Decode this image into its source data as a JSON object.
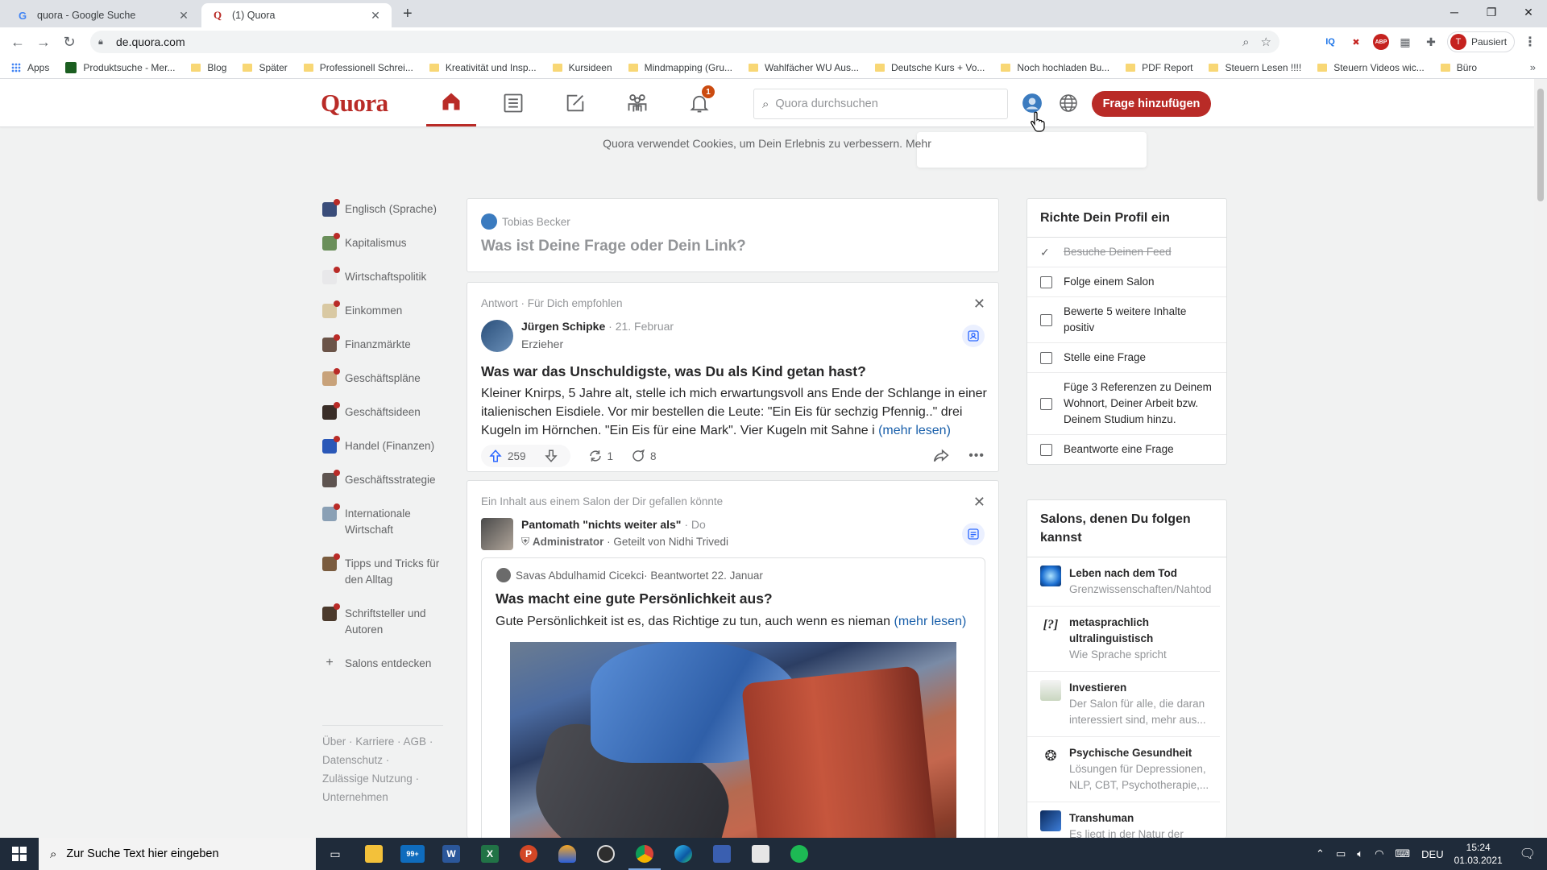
{
  "browser": {
    "tabs": [
      {
        "title": "quora - Google Suche",
        "favicon": "google-icon"
      },
      {
        "title": "(1) Quora",
        "favicon": "quora-icon"
      }
    ],
    "url": "de.quora.com",
    "profile_label": "Pausiert",
    "profile_initial": "T",
    "bookmarks": [
      "Apps",
      "Produktsuche - Mer...",
      "Blog",
      "Später",
      "Professionell Schrei...",
      "Kreativität und Insp...",
      "Kursideen",
      "Mindmapping (Gru...",
      "Wahlfächer WU Aus...",
      "Deutsche Kurs + Vo...",
      "Noch hochladen Bu...",
      "PDF Report",
      "Steuern Lesen !!!!",
      "Steuern Videos wic...",
      "Büro"
    ]
  },
  "header": {
    "logo": "Quora",
    "notification_count": "1",
    "search_placeholder": "Quora durchsuchen",
    "add_question": "Frage hinzufügen",
    "accent_color": "#b92b27"
  },
  "cookie": {
    "text": "Quora verwendet Cookies, um Dein Erlebnis zu verbessern.",
    "more": "Mehr"
  },
  "sidebar": {
    "items": [
      "Englisch (Sprache)",
      "Kapitalismus",
      "Wirtschaftspolitik",
      "Einkommen",
      "Finanzmärkte",
      "Geschäftspläne",
      "Geschäftsideen",
      "Handel (Finanzen)",
      "Geschäftsstrategie",
      "Internationale Wirtschaft",
      "Tipps und Tricks für den Alltag",
      "Schriftsteller und Autoren"
    ],
    "discover": "Salons entdecken",
    "footer": [
      "Über",
      "Karriere",
      "AGB",
      "Datenschutz",
      "Zulässige Nutzung",
      "Unternehmen"
    ]
  },
  "ask": {
    "user": "Tobias Becker",
    "prompt": "Was ist Deine Frage oder Dein Link?"
  },
  "post1": {
    "meta": "Antwort · Für Dich empfohlen",
    "author": "Jürgen Schipke",
    "date": " · 21. Februar",
    "role": "Erzieher",
    "title": "Was war das Unschuldigste, was Du als Kind getan hast?",
    "body": "Kleiner Knirps, 5 Jahre alt, stelle ich mich erwartungsvoll ans Ende der Schlange in einer italienischen Eisdiele. Vor mir bestellen die Leute: \"Ein Eis für sechzig Pfennig..\" drei Kugeln im Hörnchen. \"Ein Eis für eine Mark\". Vier Kugeln mit Sahne i",
    "more": "(mehr lesen)",
    "upvotes": "259",
    "shares": "1",
    "comments": "8"
  },
  "post2": {
    "meta": "Ein Inhalt aus einem Salon der Dir gefallen könnte",
    "author": "Pantomath \"nichts weiter als\"",
    "date": " · Do",
    "role": "Administrator",
    "shared": " · Geteilt von Nidhi Trivedi",
    "inner_author": "Savas Abdulhamid Cicekci",
    "inner_date": " · Beantwortet 22. Januar",
    "title": "Was macht eine gute Persönlichkeit aus?",
    "body": "Gute Persönlichkeit ist es, das Richtige zu tun, auch wenn es nieman",
    "more": "(mehr lesen)"
  },
  "profile_setup": {
    "title": "Richte Dein Profil ein",
    "tasks": [
      {
        "label": "Besuche Deinen Feed",
        "done": true
      },
      {
        "label": "Folge einem Salon",
        "done": false
      },
      {
        "label": "Bewerte 5 weitere Inhalte positiv",
        "done": false
      },
      {
        "label": "Stelle eine Frage",
        "done": false
      },
      {
        "label": "Füge 3 Referenzen zu Deinem Wohnort, Deiner Arbeit bzw. Deinem Studium hinzu.",
        "done": false
      },
      {
        "label": "Beantworte eine Frage",
        "done": false
      }
    ]
  },
  "salons": {
    "title": "Salons, denen Du folgen kannst",
    "items": [
      {
        "name": "Leben nach dem Tod",
        "desc": "Grenzwissenschaften/Nahtod"
      },
      {
        "name": "metasprachlich ultralinguistisch",
        "desc": "Wie Sprache spricht"
      },
      {
        "name": "Investieren",
        "desc": "Der Salon für alle, die daran interessiert sind, mehr aus..."
      },
      {
        "name": "Psychische Gesundheit",
        "desc": "Lösungen für Depressionen, NLP, CBT, Psychotherapie,..."
      },
      {
        "name": "Transhuman",
        "desc": "Es liegt in der Natur der"
      }
    ]
  },
  "taskbar": {
    "search_placeholder": "Zur Suche Text hier eingeben",
    "mail_badge": "99+",
    "lang": "DEU",
    "time": "15:24",
    "date": "01.03.2021"
  }
}
